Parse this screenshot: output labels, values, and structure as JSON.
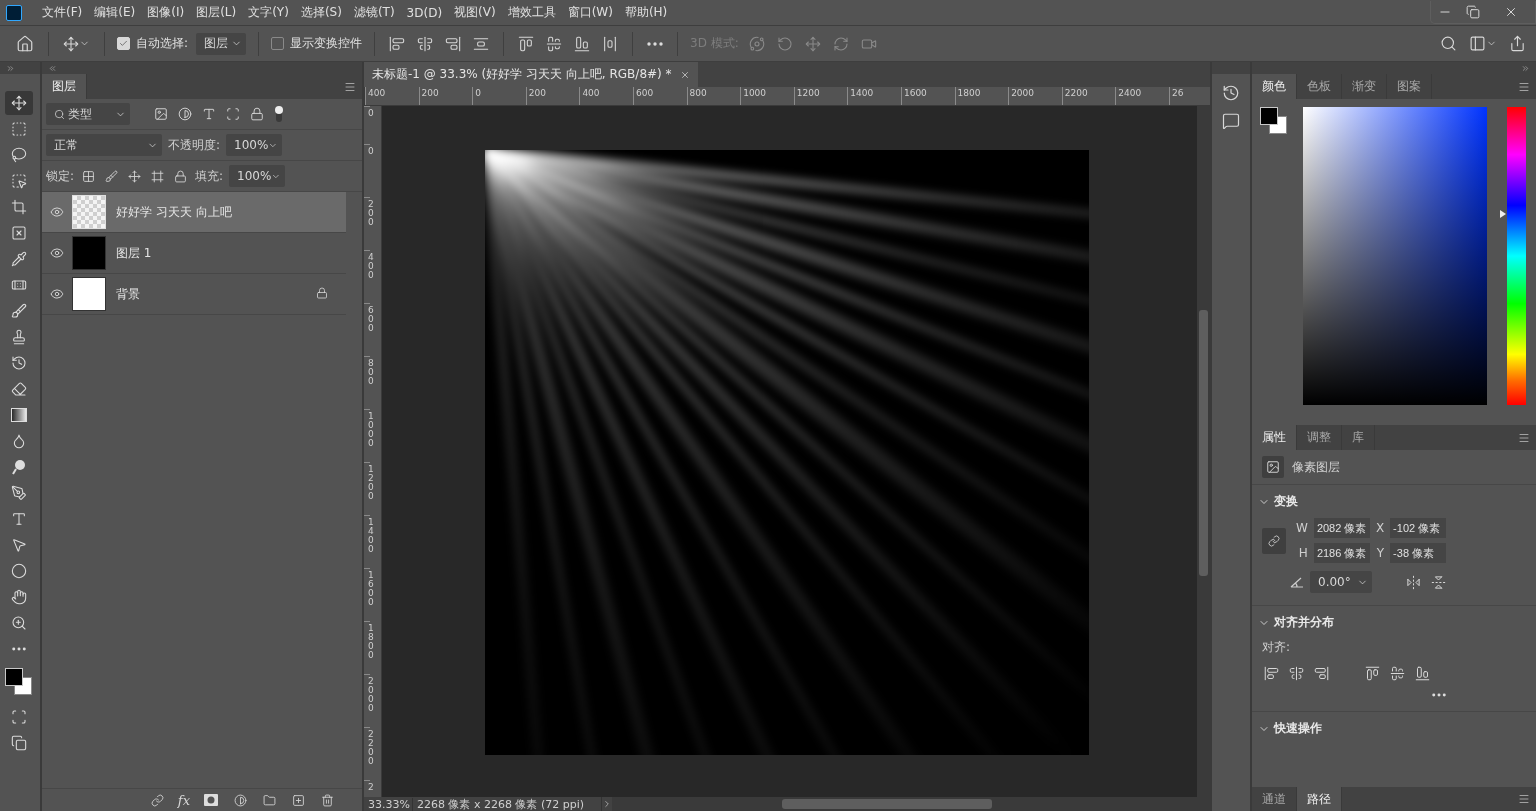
{
  "menu": [
    "文件(F)",
    "编辑(E)",
    "图像(I)",
    "图层(L)",
    "文字(Y)",
    "选择(S)",
    "滤镜(T)",
    "3D(D)",
    "视图(V)",
    "增效工具",
    "窗口(W)",
    "帮助(H)"
  ],
  "options": {
    "auto_select": {
      "label": "自动选择:",
      "checked": true,
      "target": "图层"
    },
    "show_transform": {
      "label": "显示变换控件",
      "checked": false
    },
    "mode3d": {
      "label": "3D 模式:",
      "disabled": true
    }
  },
  "tools": [
    {
      "kind": "move",
      "selected": true
    },
    {
      "kind": "marquee",
      "selected": false
    },
    {
      "kind": "lasso",
      "selected": false
    },
    {
      "kind": "object",
      "selected": false
    },
    {
      "kind": "crop",
      "selected": false
    },
    {
      "kind": "frame",
      "selected": false
    },
    {
      "kind": "eyedropper",
      "selected": false
    },
    {
      "kind": "healing",
      "selected": false
    },
    {
      "kind": "brush",
      "selected": false
    },
    {
      "kind": "stamp",
      "selected": false
    },
    {
      "kind": "history",
      "selected": false
    },
    {
      "kind": "eraser",
      "selected": false
    },
    {
      "kind": "gradient",
      "selected": false
    },
    {
      "kind": "blur",
      "selected": false
    },
    {
      "kind": "dodge",
      "selected": false
    },
    {
      "kind": "pen",
      "selected": false
    },
    {
      "kind": "type",
      "selected": false
    },
    {
      "kind": "path",
      "selected": false
    },
    {
      "kind": "ellipse",
      "selected": false
    },
    {
      "kind": "hand",
      "selected": false
    },
    {
      "kind": "zoom",
      "selected": false
    },
    {
      "kind": "more",
      "selected": false
    }
  ],
  "layers_panel": {
    "tab": "图层",
    "filter": "类型",
    "blend_mode": "正常",
    "opacity_label": "不透明度:",
    "opacity": "100%",
    "lock_label": "锁定:",
    "fill_label": "填充:",
    "fill": "100%",
    "fx": "fx",
    "layers": [
      {
        "name": "好好学 习天天 向上吧",
        "kind": "transparent",
        "visible": true,
        "selected": true,
        "locked": false
      },
      {
        "name": "图层 1",
        "kind": "black",
        "visible": true,
        "selected": false,
        "locked": false
      },
      {
        "name": "背景",
        "kind": "white",
        "visible": true,
        "selected": false,
        "locked": true
      }
    ]
  },
  "document": {
    "tab_title": "未标题-1 @ 33.3% (好好学 习天天 向上吧, RGB/8#) *",
    "h_ruler": [
      "400",
      "200",
      "0",
      "200",
      "400",
      "600",
      "800",
      "1000",
      "1200",
      "1400",
      "1600",
      "1800",
      "2000",
      "2200",
      "2400",
      "26"
    ],
    "v_ruler": [
      "0",
      "0",
      "200",
      "400",
      "600",
      "800",
      "1000",
      "1200",
      "1400",
      "1600",
      "1800",
      "2000",
      "2200",
      "2"
    ],
    "zoom": "33.33%",
    "info": "2268 像素 x 2268 像素 (72 ppi)"
  },
  "color_panel": {
    "hue": {
      "level": 0.64
    },
    "tabs": [
      {
        "label": "颜色",
        "selected": true
      },
      {
        "label": "色板",
        "selected": false
      },
      {
        "label": "渐变",
        "selected": false
      },
      {
        "label": "图案",
        "selected": false
      }
    ]
  },
  "properties_panel": {
    "tabs": [
      {
        "label": "属性",
        "selected": true
      },
      {
        "label": "调整",
        "selected": false
      },
      {
        "label": "库",
        "selected": false
      }
    ],
    "layer_type": "像素图层",
    "transform": {
      "title": "变换",
      "expanded": true,
      "fields": [
        {
          "label": "W",
          "value": "2082 像素"
        },
        {
          "label": "X",
          "value": "-102 像素"
        },
        {
          "label": "H",
          "value": "2186 像素"
        },
        {
          "label": "Y",
          "value": "-38 像素"
        }
      ],
      "angle": "0.00°"
    },
    "align": {
      "title": "对齐并分布",
      "expanded": true,
      "label": "对齐:"
    },
    "quick_actions": {
      "title": "快速操作",
      "expanded": true
    }
  },
  "bottom_tabs": [
    {
      "label": "通道",
      "selected": false
    },
    {
      "label": "路径",
      "selected": true
    }
  ]
}
